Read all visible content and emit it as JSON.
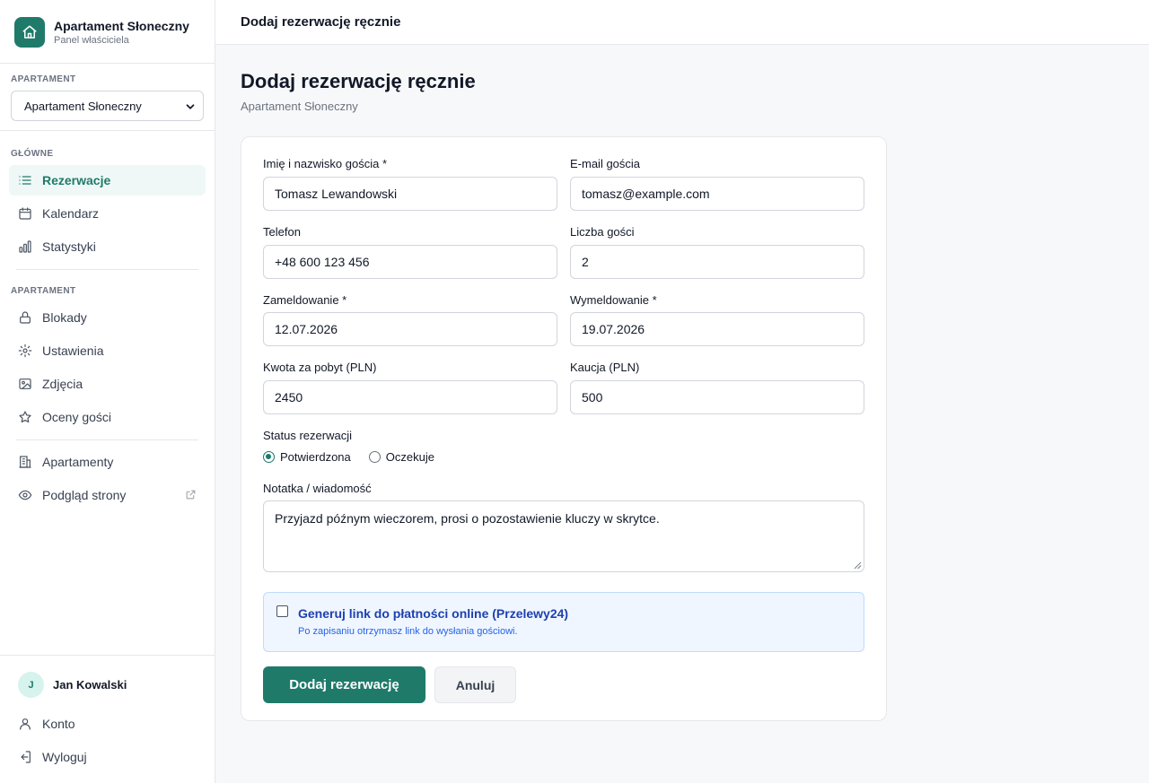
{
  "brand": {
    "name": "Apartament Słoneczny",
    "subtitle": "Panel właściciela"
  },
  "sidebar": {
    "apartment_section": "APARTAMENT",
    "apartment_select": "Apartament Słoneczny",
    "main_section": "GŁÓWNE",
    "main_items": [
      {
        "label": "Rezerwacje",
        "icon": "list-icon",
        "active": true
      },
      {
        "label": "Kalendarz",
        "icon": "calendar-icon"
      },
      {
        "label": "Statystyki",
        "icon": "bar-chart-icon"
      }
    ],
    "apartment_items_section": "APARTAMENT",
    "apartment_items": [
      {
        "label": "Blokady",
        "icon": "lock-icon"
      },
      {
        "label": "Ustawienia",
        "icon": "gear-icon"
      },
      {
        "label": "Zdjęcia",
        "icon": "image-icon"
      },
      {
        "label": "Oceny gości",
        "icon": "star-icon"
      }
    ],
    "extra_items": [
      {
        "label": "Apartamenty",
        "icon": "building-icon"
      },
      {
        "label": "Podgląd strony",
        "icon": "eye-icon"
      }
    ],
    "user": {
      "initial": "J",
      "name": "Jan Kowalski"
    },
    "account_items": [
      {
        "label": "Konto",
        "icon": "user-icon"
      },
      {
        "label": "Wyloguj",
        "icon": "logout-icon"
      }
    ]
  },
  "topbar": {
    "title": "Dodaj rezerwację ręcznie"
  },
  "page": {
    "title": "Dodaj rezerwację ręcznie",
    "subtitle": "Apartament Słoneczny"
  },
  "form": {
    "name_label": "Imię i nazwisko gościa *",
    "name_value": "Tomasz Lewandowski",
    "email_label": "E-mail gościa",
    "email_value": "tomasz@example.com",
    "phone_label": "Telefon",
    "phone_value": "+48 600 123 456",
    "guests_label": "Liczba gości",
    "guests_value": "2",
    "checkin_label": "Zameldowanie *",
    "checkin_value": "12.07.2026",
    "checkout_label": "Wymeldowanie *",
    "checkout_value": "19.07.2026",
    "amount_label": "Kwota za pobyt (PLN)",
    "amount_value": "2450",
    "deposit_label": "Kaucja (PLN)",
    "deposit_value": "500",
    "status_label": "Status rezerwacji",
    "status_options": [
      "Potwierdzona",
      "Oczekuje"
    ],
    "status_selected": "Potwierdzona",
    "note_label": "Notatka / wiadomość",
    "note_value": "Przyjazd późnym wieczorem, prosi o pozostawienie kluczy w skrytce.",
    "payment_title": "Generuj link do płatności online (Przelewy24)",
    "payment_sub": "Po zapisaniu otrzymasz link do wysłania gościowi.",
    "payment_checked": false,
    "submit_label": "Dodaj rezerwację",
    "cancel_label": "Anuluj"
  },
  "colors": {
    "accent": "#1f7a6a",
    "info_bg": "#eff6ff",
    "info_text": "#1e40af"
  }
}
